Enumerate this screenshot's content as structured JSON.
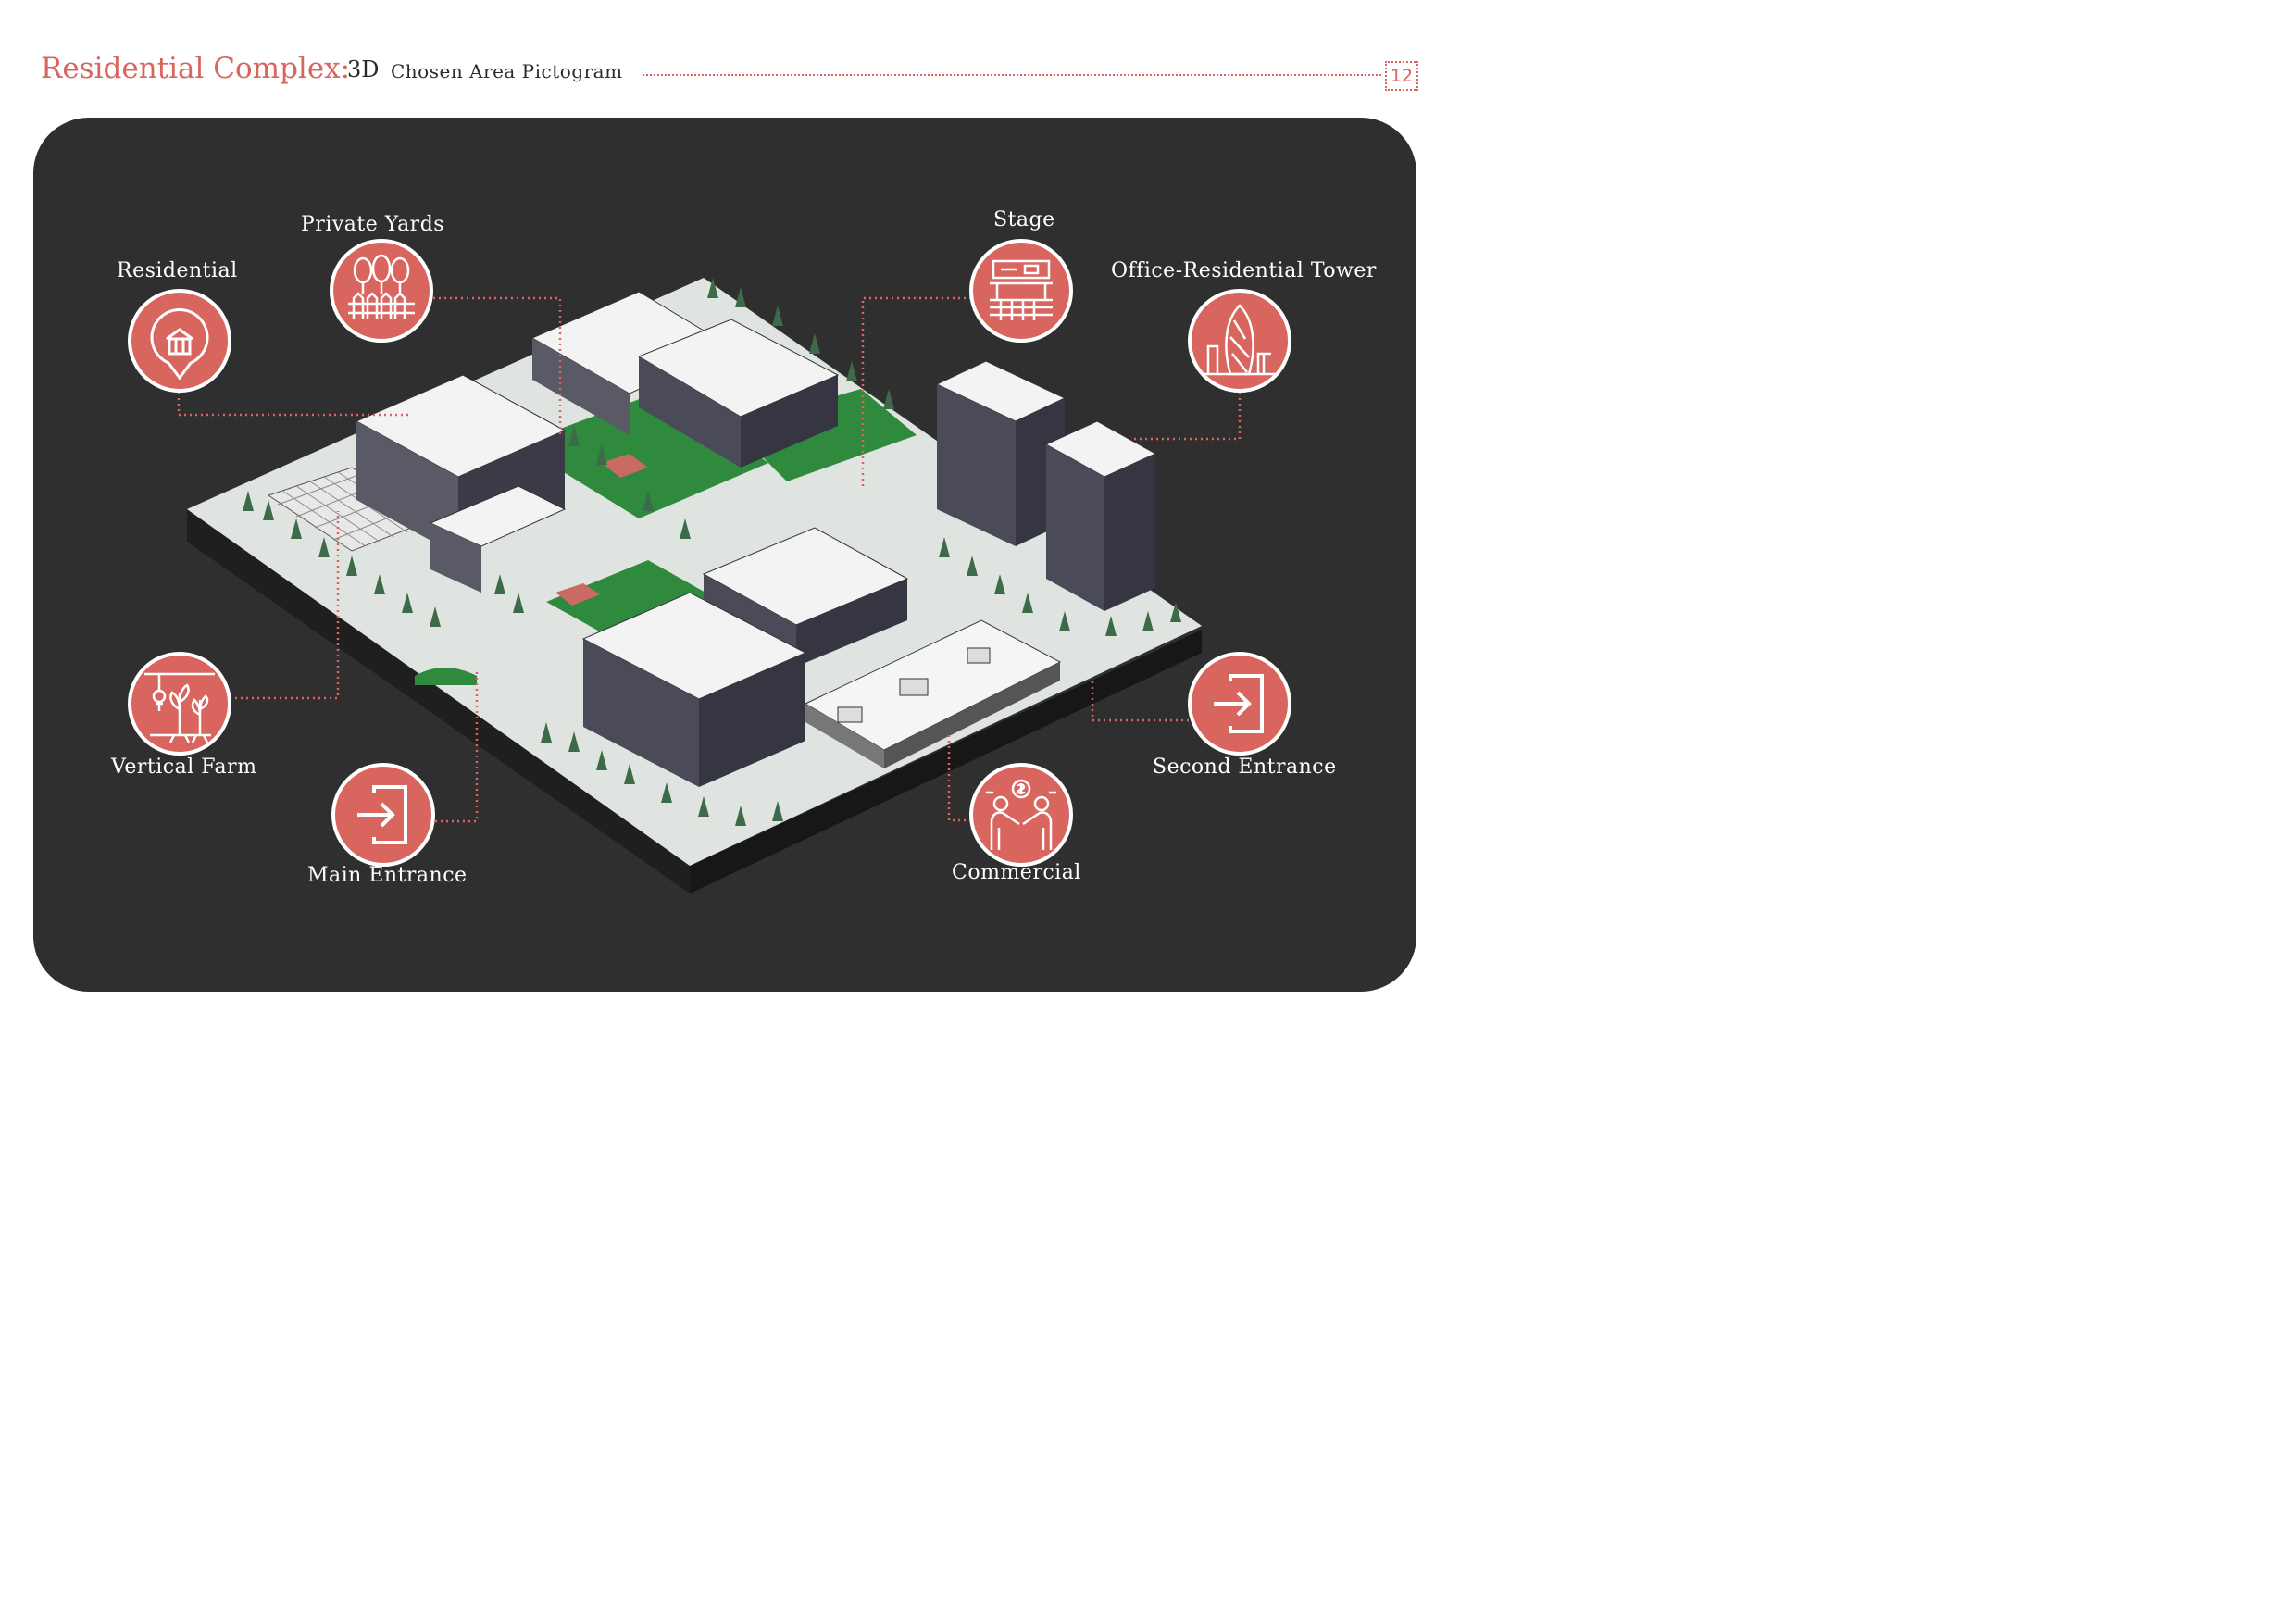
{
  "header": {
    "title": "Residential Complex:",
    "subtitle_prefix": "3D",
    "subtitle": "Chosen Area Pictogram",
    "page_number": "12"
  },
  "callouts": [
    {
      "id": "residential",
      "label": "Residential",
      "icon": "home-pin-icon"
    },
    {
      "id": "private-yards",
      "label": "Private Yards",
      "icon": "trees-fence-icon"
    },
    {
      "id": "stage",
      "label": "Stage",
      "icon": "stage-icon"
    },
    {
      "id": "office-tower",
      "label": "Office-Residential Tower",
      "icon": "skyscraper-icon"
    },
    {
      "id": "vertical-farm",
      "label": "Vertical Farm",
      "icon": "plant-farm-icon"
    },
    {
      "id": "main-entrance",
      "label": "Main Entrance",
      "icon": "entrance-arrow-icon"
    },
    {
      "id": "commercial",
      "label": "Commercial",
      "icon": "handshake-dollar-icon"
    },
    {
      "id": "second-entrance",
      "label": "Second Entrance",
      "icon": "entrance-arrow-icon"
    }
  ],
  "colors": {
    "accent": "#d9655f",
    "panel": "#2f2f2f",
    "ground": "#dfe4e1",
    "grass": "#2f8a3e",
    "tree": "#3d6b4a",
    "building": "#f3f3f3"
  }
}
